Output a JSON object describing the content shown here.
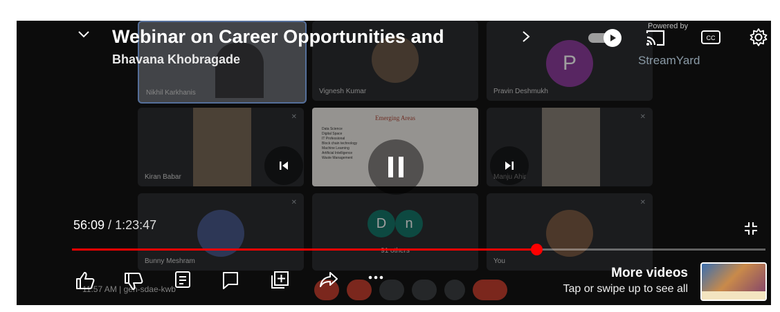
{
  "video": {
    "title": "Webinar on Career Opportunities and",
    "channel": "Bhavana Khobragade",
    "current_time": "56:09",
    "time_sep": " / ",
    "duration": "1:23:47",
    "progress": 0.67
  },
  "meeting": {
    "participants": [
      {
        "name": "Nikhil Karkhanis"
      },
      {
        "name": "Vignesh Kumar"
      },
      {
        "name": "Pravin Deshmukh",
        "initial": "P"
      },
      {
        "name": "Kiran Babar"
      },
      {
        "name": "Manju Ahir"
      },
      {
        "name": "Bunny Meshram"
      },
      {
        "name": "You"
      }
    ],
    "others_initials": [
      "D",
      "n"
    ],
    "others_label": "91 others",
    "slide_title": "Emerging Areas",
    "slide_items": [
      "Data Science",
      "Digital Space",
      "IT Professional",
      "Block chain technology",
      "Machine Learning",
      "Artificial Intelligence",
      "Waste Management"
    ],
    "clock": "11:57 AM",
    "meeting_code": "geh-sdae-kwb"
  },
  "watermark": {
    "powered": "Powered by",
    "brand": "StreamYard"
  },
  "more_videos": {
    "title": "More videos",
    "subtitle": "Tap or swipe up to see all"
  },
  "colors": {
    "progress": "#ff0000",
    "avatar_p": "#8e3e9e",
    "avatar_d": "#16776a"
  }
}
